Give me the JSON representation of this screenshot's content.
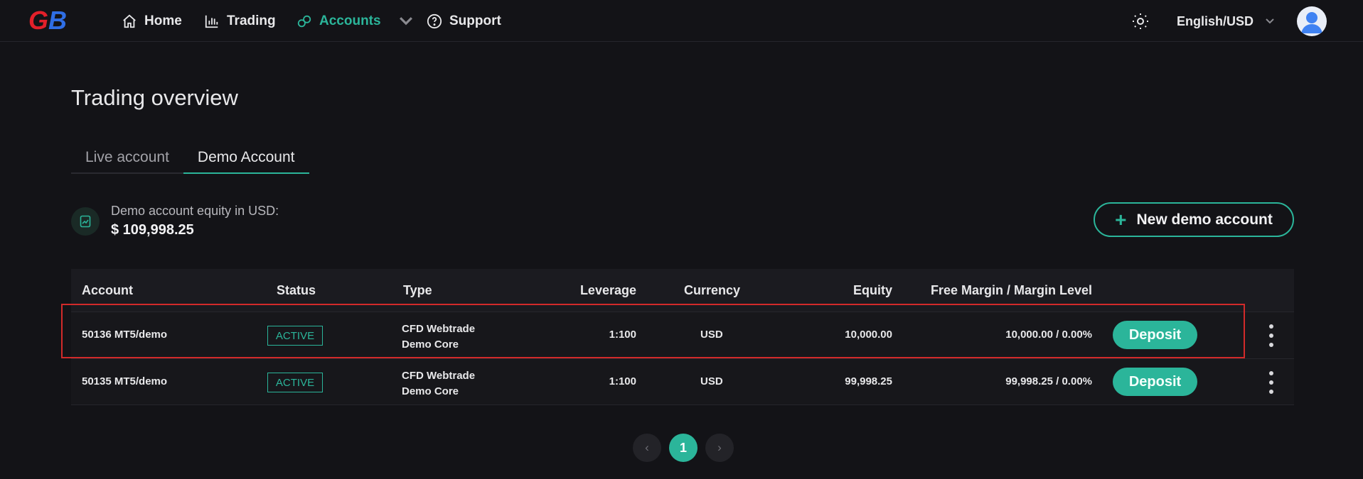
{
  "brand": {
    "logo_text": "GB",
    "color_g": "#e3202a",
    "color_b": "#2f6ee5"
  },
  "nav": {
    "items": [
      {
        "label": "Home",
        "icon": "home-icon"
      },
      {
        "label": "Trading",
        "icon": "bar-chart-icon"
      },
      {
        "label": "Accounts",
        "icon": "accounts-icon",
        "active": true,
        "has_dropdown": true
      },
      {
        "label": "Support",
        "icon": "help-circle-icon"
      }
    ],
    "language": "English/USD"
  },
  "page": {
    "title": "Trading overview",
    "tabs": [
      {
        "label": "Live account",
        "active": false
      },
      {
        "label": "Demo Account",
        "active": true
      }
    ]
  },
  "equity": {
    "label": "Demo account equity in USD:",
    "value": "$ 109,998.25"
  },
  "actions": {
    "new_demo_label": "New demo account"
  },
  "table": {
    "headers": [
      "Account",
      "Status",
      "Type",
      "Leverage",
      "Currency",
      "Equity",
      "Free Margin / Margin Level"
    ],
    "rows": [
      {
        "account": "50136 MT5/demo",
        "status": "ACTIVE",
        "type_line1": "CFD Webtrade",
        "type_line2": "Demo Core",
        "leverage": "1:100",
        "currency": "USD",
        "equity": "10,000.00",
        "free_margin": "10,000.00 / 0.00%",
        "action": "Deposit"
      },
      {
        "account": "50135 MT5/demo",
        "status": "ACTIVE",
        "type_line1": "CFD Webtrade",
        "type_line2": "Demo Core",
        "leverage": "1:100",
        "currency": "USD",
        "equity": "99,998.25",
        "free_margin": "99,998.25 / 0.00%",
        "action": "Deposit"
      }
    ]
  },
  "pagination": {
    "prev": "‹",
    "current": "1",
    "next": "›"
  },
  "colors": {
    "accent": "#2bb59a",
    "highlight": "#d22a2a",
    "background": "#131317"
  }
}
